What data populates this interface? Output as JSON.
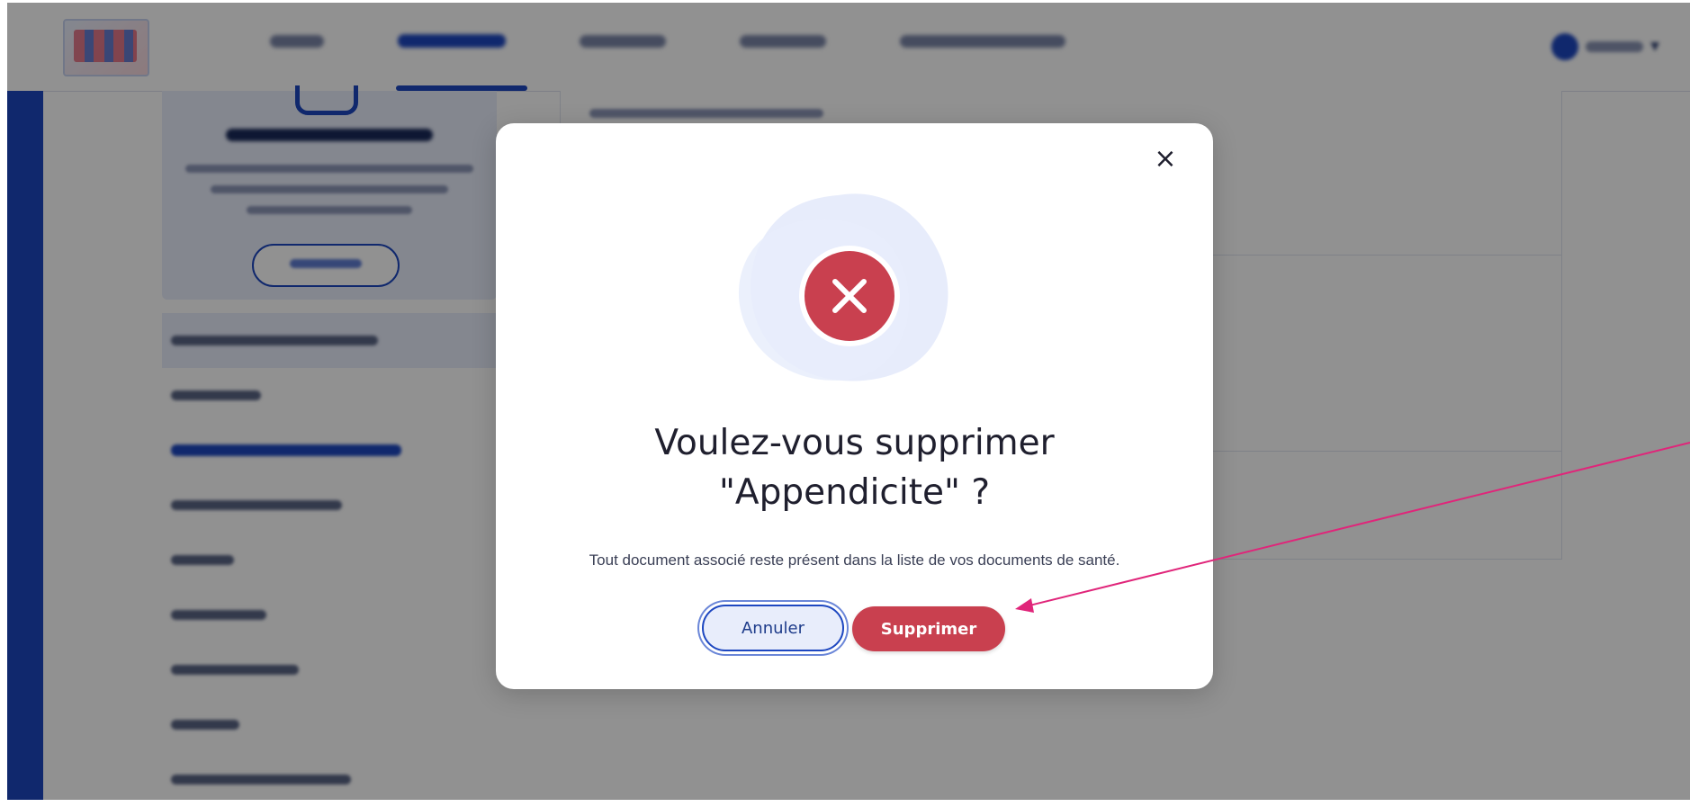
{
  "modal": {
    "title_line1": "Voulez-vous supprimer",
    "title_line2": "\"Appendicite\" ?",
    "message": "Tout document associé reste présent dans la liste de vos documents de santé.",
    "cancel_label": "Annuler",
    "delete_label": "Supprimer",
    "close_symbol": "×",
    "icon": "error-x-icon",
    "accent_color": "#c9404f",
    "brand_color": "#1d47c0"
  },
  "annotation": {
    "arrow_color": "#e0257a"
  }
}
